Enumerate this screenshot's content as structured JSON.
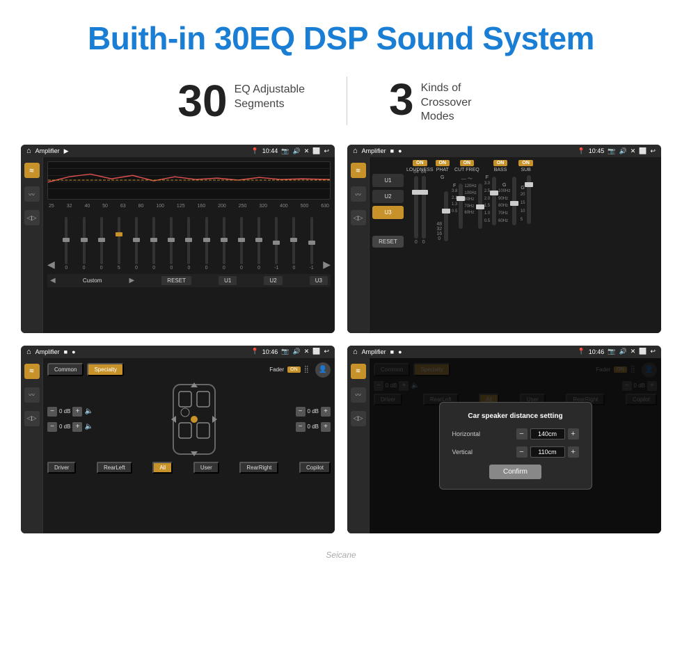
{
  "header": {
    "title": "Buith-in 30EQ DSP Sound System"
  },
  "stats": [
    {
      "number": "30",
      "label": "EQ Adjustable\nSegments"
    },
    {
      "number": "3",
      "label": "Kinds of\nCrossover Modes"
    }
  ],
  "screens": [
    {
      "id": "eq-screen",
      "time": "10:44",
      "title": "Amplifier",
      "type": "eq"
    },
    {
      "id": "crossover-screen",
      "time": "10:45",
      "title": "Amplifier",
      "type": "crossover"
    },
    {
      "id": "specialty-screen",
      "time": "10:46",
      "title": "Amplifier",
      "type": "specialty"
    },
    {
      "id": "dialog-screen",
      "time": "10:46",
      "title": "Amplifier",
      "type": "dialog"
    }
  ],
  "eq": {
    "frequencies": [
      "25",
      "32",
      "40",
      "50",
      "63",
      "80",
      "100",
      "125",
      "160",
      "200",
      "250",
      "320",
      "400",
      "500",
      "630"
    ],
    "buttons": {
      "custom": "Custom",
      "reset": "RESET",
      "u1": "U1",
      "u2": "U2",
      "u3": "U3"
    }
  },
  "crossover": {
    "presets": [
      "U1",
      "U2",
      "U3"
    ],
    "channels": [
      "LOUDNESS",
      "PHAT",
      "CUT FREQ",
      "BASS",
      "SUB"
    ],
    "reset": "RESET"
  },
  "specialty": {
    "tabs": [
      "Common",
      "Specialty"
    ],
    "fader": "Fader",
    "zones": [
      "Driver",
      "RearLeft",
      "All",
      "User",
      "RearRight",
      "Copilot"
    ],
    "db_values": [
      "0 dB",
      "0 dB",
      "0 dB",
      "0 dB"
    ]
  },
  "dialog": {
    "title": "Car speaker distance setting",
    "horizontal_label": "Horizontal",
    "horizontal_value": "140cm",
    "vertical_label": "Vertical",
    "vertical_value": "110cm",
    "confirm": "Confirm"
  },
  "watermark": "Seicane"
}
